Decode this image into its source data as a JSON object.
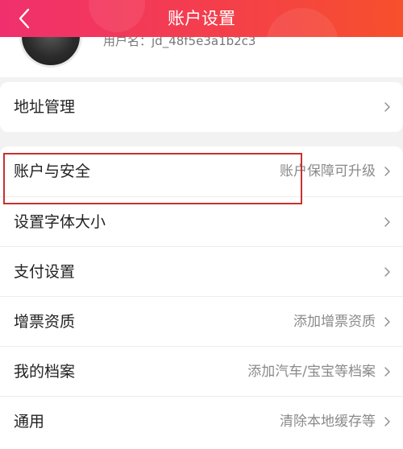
{
  "header": {
    "title": "账户设置",
    "back_icon": "chevron-left-icon",
    "gradient_colors": [
      "#f0306e",
      "#f7502c"
    ]
  },
  "profile": {
    "username_partial": "用户名：jd_48f5e3a1b2c3"
  },
  "address_section": {
    "label": "地址管理",
    "value": ""
  },
  "settings": [
    {
      "name": "account-security",
      "label": "账户与安全",
      "value": "账户保障可升级"
    },
    {
      "name": "font-size",
      "label": "设置字体大小",
      "value": ""
    },
    {
      "name": "payment",
      "label": "支付设置",
      "value": ""
    },
    {
      "name": "vat-invoice",
      "label": "增票资质",
      "value": "添加增票资质"
    },
    {
      "name": "my-profile",
      "label": "我的档案",
      "value": "添加汽车/宝宝等档案"
    },
    {
      "name": "general",
      "label": "通用",
      "value": "清除本地缓存等"
    }
  ],
  "colors": {
    "highlight": "#c8302e",
    "background": "#f2f2f2"
  }
}
